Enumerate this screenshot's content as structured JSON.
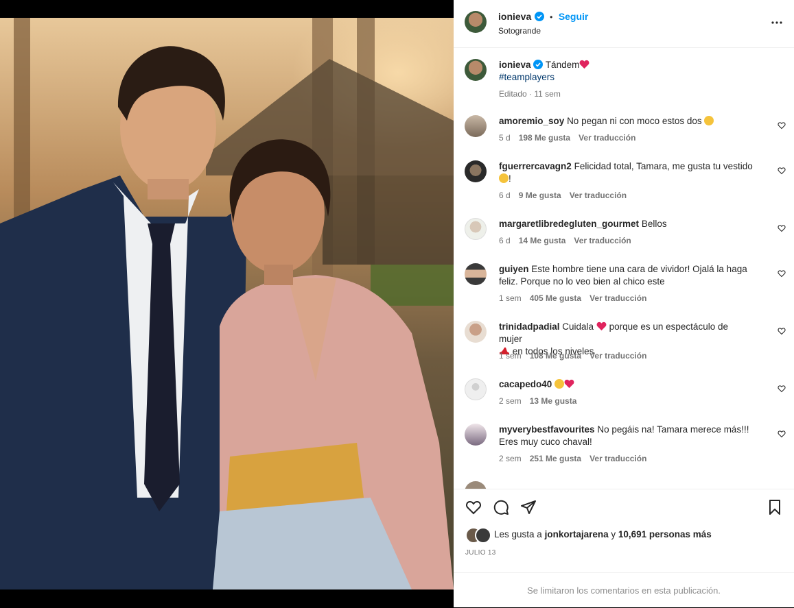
{
  "post": {
    "author": "ionieva",
    "follow_label": "Seguir",
    "location": "Sotogrande",
    "caption_text": "Tándem",
    "hashtag": "#teamplayers",
    "edited": "Editado · 11 sem"
  },
  "comments": [
    {
      "user": "amoremio_soy",
      "text": "No pegan ni con moco estos dos",
      "emoji": "😂",
      "time": "5 d",
      "likes": "198 Me gusta",
      "translate": "Ver traducción"
    },
    {
      "user": "fguerrercavagn2",
      "text": "Felicidad total, Tamara, me gusta tu vestido",
      "emoji": "😏",
      "text_after": "!",
      "time": "6 d",
      "likes": "9 Me gusta",
      "translate": "Ver traducción"
    },
    {
      "user": "margaretlibredegluten_gourmet",
      "text": "Bellos",
      "time": "6 d",
      "likes": "14 Me gusta",
      "translate": "Ver traducción"
    },
    {
      "user": "guiyen",
      "text": "Este hombre tiene una cara de vividor! Ojalá la haga feliz. Porque no lo veo bien al chico este",
      "time": "1 sem",
      "likes": "405 Me gusta",
      "translate": "Ver traducción"
    },
    {
      "user": "trinidadpadial",
      "text": "Cuidala",
      "text_mid": "porque es un espectáculo de mujer",
      "text_after": "en todos los niveles",
      "time": "1 sem",
      "likes": "108 Me gusta",
      "translate": "Ver traducción"
    },
    {
      "user": "cacapedo40",
      "text": "",
      "time": "2 sem",
      "likes": "13 Me gusta"
    },
    {
      "user": "myverybestfavourites",
      "text": "No pegáis na! Tamara merece más!!! Eres muy cuco chaval!",
      "time": "2 sem",
      "likes": "251 Me gusta",
      "translate": "Ver traducción"
    }
  ],
  "likes_line": {
    "prefix": "Les gusta a",
    "user": "jonkortajarena",
    "middle": "y",
    "count": "10,691 personas más"
  },
  "date": "JULIO 13",
  "footer_text": "Se limitaron los comentarios en esta publicación.",
  "colors": {
    "accent": "#0095f6",
    "heart": "#ed4956",
    "text": "#262626",
    "muted": "#737373"
  }
}
